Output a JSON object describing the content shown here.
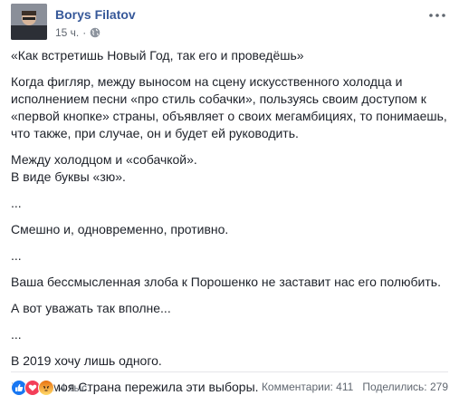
{
  "post": {
    "author": "Borys Filatov",
    "time": "15 ч.",
    "paragraphs": [
      [
        "«Как встретишь Новый Год, так его и проведёшь»"
      ],
      [
        "Когда фигляр, между выносом на сцену искусственного холодца и",
        "исполнением песни «про стиль собачки», пользуясь своим доступом к",
        "«первой кнопке» страны, объявляет о своих мегамбициях, то понимаешь,",
        "что также, при случае, он и будет ей руководить."
      ],
      [
        "Между холодцом и «собачкой».",
        "В виде буквы «зю»."
      ],
      [
        "..."
      ],
      [
        "Смешно и, одновременно, противно."
      ],
      [
        "..."
      ],
      [
        "Ваша бессмысленная злоба к Порошенко не заставит нас его полюбить."
      ],
      [
        "А вот уважать так вполне..."
      ],
      [
        "..."
      ],
      [
        "В 2019 хочу лишь одного."
      ],
      [
        "Чтобы моя Страна пережила эти выборы."
      ]
    ]
  },
  "footer": {
    "reactions_count": "4 тыс.",
    "reactions": [
      {
        "icon": "like-reaction-icon",
        "color": "#1877f2"
      },
      {
        "icon": "love-reaction-icon",
        "color": "#f33e58"
      },
      {
        "icon": "angry-reaction-icon",
        "color": "#e9710f"
      }
    ],
    "comments": "Комментарии: 411",
    "shares": "Поделились: 279"
  },
  "colors": {
    "author": "#365899",
    "text": "#1d2129",
    "meta": "#606770"
  }
}
